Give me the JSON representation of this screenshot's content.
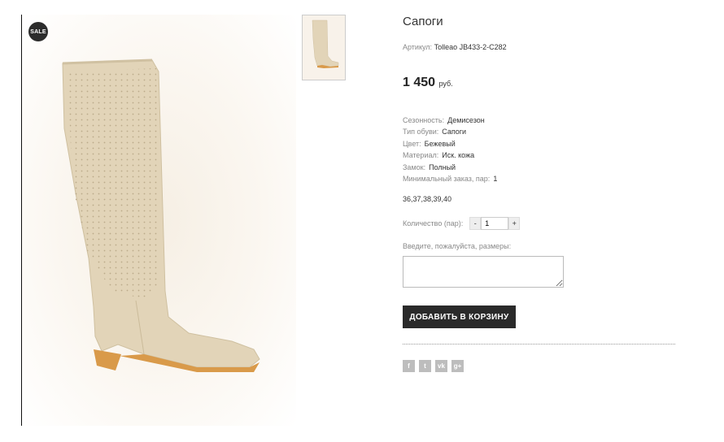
{
  "product": {
    "sale_badge": "SALE",
    "title": "Сапоги",
    "sku_label": "Артикул:",
    "sku_value": "Tolleao JB433-2-C282",
    "price_value": "1 450",
    "price_currency": "руб.",
    "attributes": [
      {
        "label": "Сезонность:",
        "value": "Демисезон"
      },
      {
        "label": "Тип обуви:",
        "value": "Сапоги"
      },
      {
        "label": "Цвет:",
        "value": "Бежевый"
      },
      {
        "label": "Материал:",
        "value": "Иск. кожа"
      },
      {
        "label": "Замок:",
        "value": "Полный"
      },
      {
        "label": "Минимальный заказ, пар:",
        "value": "1"
      }
    ],
    "sizes": "36,37,38,39,40"
  },
  "quantity": {
    "label": "Количество (пар):",
    "minus": "-",
    "value": "1",
    "plus": "+"
  },
  "size_input": {
    "label": "Введите, пожалуйста, размеры:",
    "value": ""
  },
  "add_to_cart_label": "ДОБАВИТЬ В КОРЗИНУ",
  "social": [
    {
      "name": "facebook-icon",
      "glyph": "f"
    },
    {
      "name": "twitter-icon",
      "glyph": "t"
    },
    {
      "name": "vk-icon",
      "glyph": "vk"
    },
    {
      "name": "google-plus-icon",
      "glyph": "g+"
    }
  ],
  "colors": {
    "button_bg": "#2a2a2a",
    "boot": "#e2d4b8",
    "sole": "#d99a4a",
    "social_icon_bg": "#bdbdbd"
  }
}
